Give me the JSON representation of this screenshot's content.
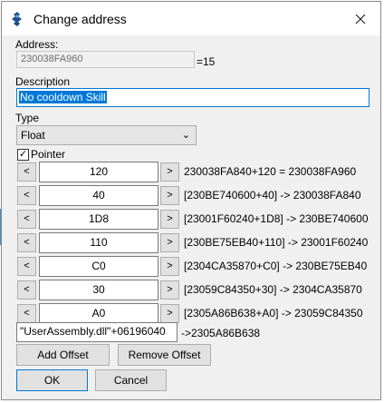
{
  "window": {
    "title": "Change address"
  },
  "address": {
    "label": "Address:",
    "value": "230038FA960",
    "suffix": "=15"
  },
  "description": {
    "label": "Description",
    "value": "No cooldown Skill"
  },
  "type": {
    "label": "Type",
    "selected": "Float"
  },
  "pointer": {
    "label": "Pointer",
    "checked": true,
    "check_glyph": "✓"
  },
  "offsets": [
    {
      "offset": "120",
      "result": "230038FA840+120 = 230038FA960"
    },
    {
      "offset": "40",
      "result": "[230BE740600+40] -> 230038FA840"
    },
    {
      "offset": "1D8",
      "result": "[23001F60240+1D8] -> 230BE740600"
    },
    {
      "offset": "110",
      "result": "[230BE75EB40+110] -> 23001F60240"
    },
    {
      "offset": "C0",
      "result": "[2304CA35870+C0] -> 230BE75EB40"
    },
    {
      "offset": "30",
      "result": "[23059C84350+30] -> 2304CA35870"
    },
    {
      "offset": "A0",
      "result": "[2305A86B638+A0] -> 23059C84350"
    }
  ],
  "step": {
    "dec": "<",
    "inc": ">"
  },
  "base": {
    "value": "\"UserAssembly.dll\"+06196040",
    "result": "->2305A86B638"
  },
  "buttons": {
    "add_offset": "Add Offset",
    "remove_offset": "Remove Offset",
    "ok": "OK",
    "cancel": "Cancel"
  },
  "icons": {
    "app": "cheat-engine-icon",
    "close": "close-icon",
    "dropdown": "chevron-down-icon"
  }
}
